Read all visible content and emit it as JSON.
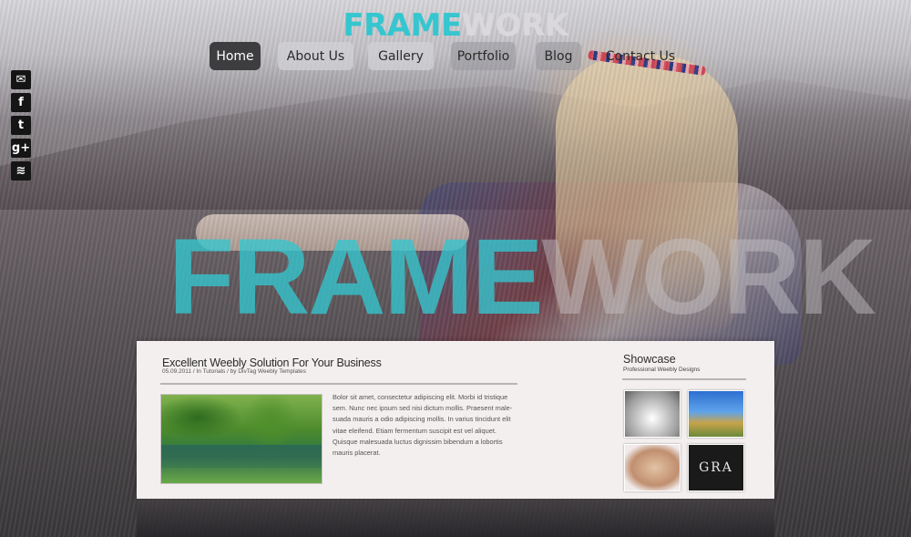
{
  "logo": {
    "part1": "FRAME",
    "part2": "WORK"
  },
  "nav": [
    {
      "label": "Home"
    },
    {
      "label": "About Us"
    },
    {
      "label": "Gallery"
    },
    {
      "label": "Portfolio"
    },
    {
      "label": "Blog"
    },
    {
      "label": "Contact Us"
    }
  ],
  "social": {
    "email": "✉",
    "facebook": "f",
    "twitter": "t",
    "googleplus": "g+",
    "rss": "≋"
  },
  "hero_word": {
    "part1": "FRAME",
    "part2": "WORK"
  },
  "post": {
    "title": "Excellent Weebly Solution For Your Business",
    "meta": "05.09.2011 / In Tutorials / by DivTag Weebly Templates",
    "body": "Bolor sit amet, consectetur adipiscing elit. Morbi id tristique sem. Nunc nec ipsum sed nisi dictum mollis. Praesent male-suada mauris a odio adipiscing mollis. In varius tincidunt elit vitae eleifend. Etiam fermentum suscipit est vel aliquet. Quisque malesuada luctus dignissim bibendum a lobortis mauris placerat."
  },
  "showcase": {
    "title": "Showcase",
    "subtitle": "Professional Weebly Designs",
    "thumb4_text": "GRA"
  }
}
